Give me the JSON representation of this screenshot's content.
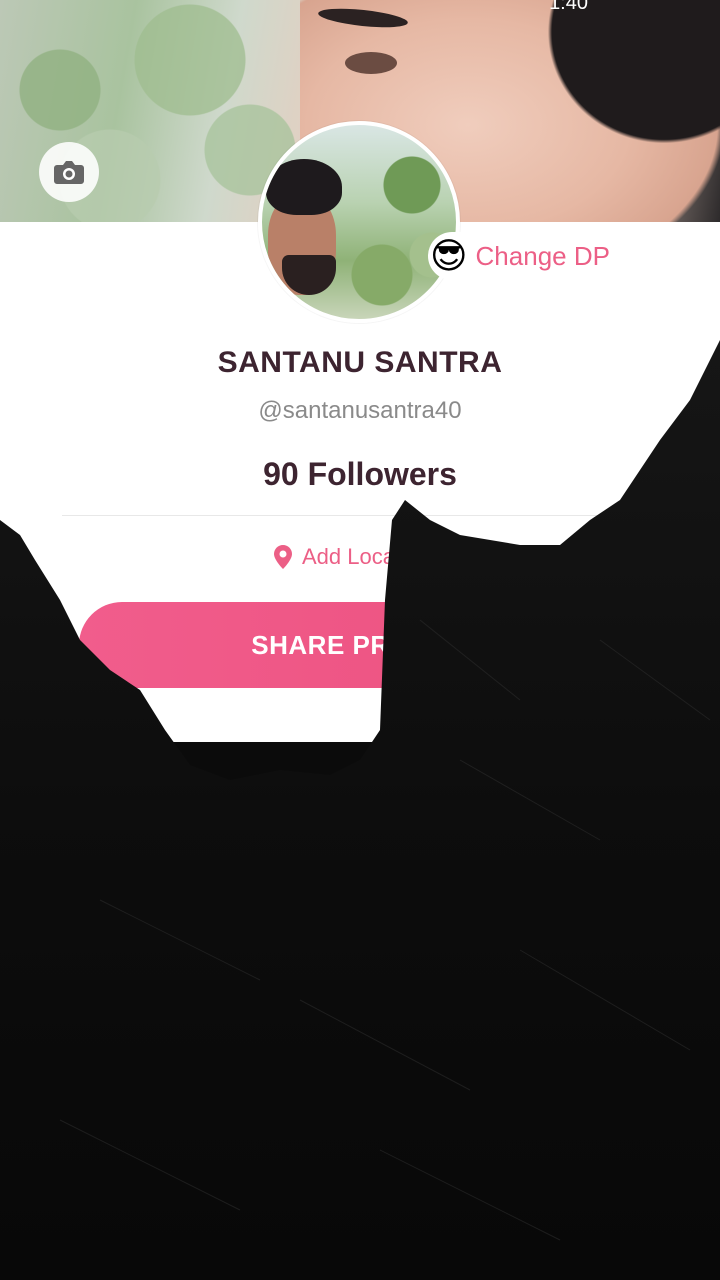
{
  "status_bar": {
    "time": "1:40"
  },
  "profile": {
    "name": "SANTANU SANTRA",
    "handle": "@santanusantra40",
    "followers": "90 Followers"
  },
  "actions": {
    "change_dp_emoji": "😎",
    "change_dp_label": "Change DP",
    "add_location_label": "Add Location",
    "share_label": "SHARE PROFILE"
  },
  "colors": {
    "accent": "#EC5F86",
    "name_text": "#3D2430",
    "muted_text": "#8A8A8A"
  },
  "icons": {
    "cover_camera": "camera-icon",
    "location": "location-pin-icon"
  }
}
